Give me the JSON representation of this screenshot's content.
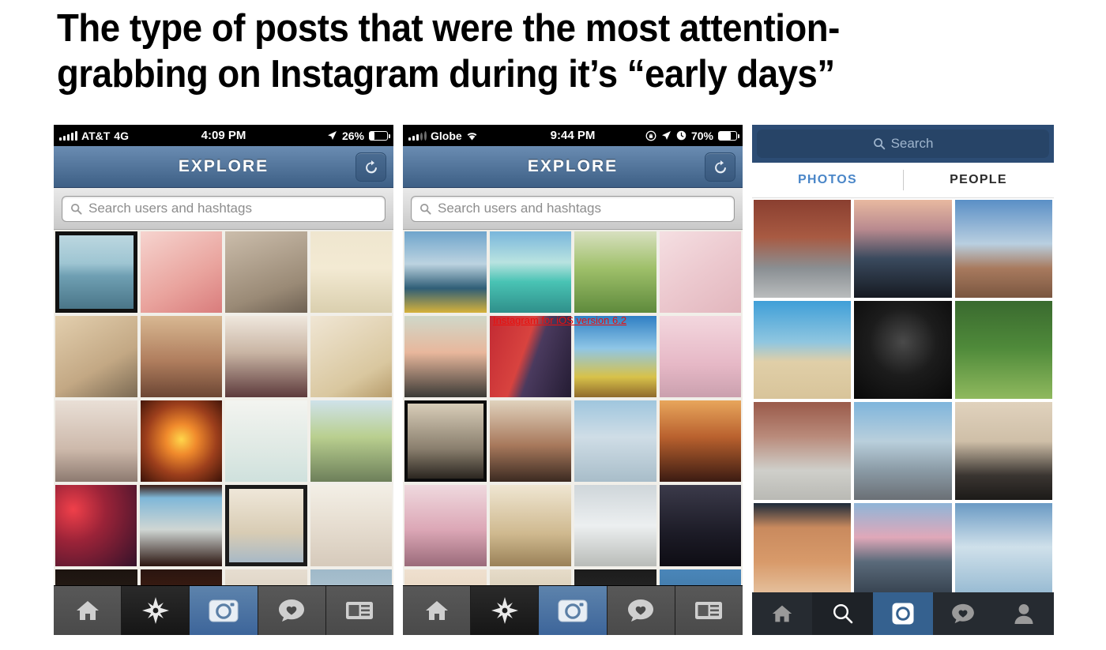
{
  "slide": {
    "title": "The type of posts that were the most attention-grabbing on Instagram during it’s “early days”",
    "background": "#ffffff",
    "annotation": {
      "text": "Instagram for iOS version 6.2",
      "color": "#e8100f"
    }
  },
  "phones": [
    {
      "id": "phone-1",
      "os_style": "ios6",
      "status_bar": {
        "carrier": "AT&T",
        "network": "4G",
        "time": "4:09 PM",
        "battery_percent": "26%",
        "battery_level": 26,
        "icons": [
          "signal-bars-icon",
          "location-arrow-icon",
          "battery-icon"
        ]
      },
      "navbar": {
        "title": "EXPLORE",
        "right_button": "refresh-icon",
        "gradient_top": "#6a8cb2",
        "gradient_bottom": "#3d5f85"
      },
      "search": {
        "placeholder": "Search users and hashtags",
        "icon": "search-icon"
      },
      "grid": {
        "columns": 4,
        "rows": 5,
        "photos": [
          "golden-gate-bridge-bay-view",
          "pink-ladybug-nail-art",
          "jewelry-scattered-on-carpet",
          "cartoon-character-on-tv-screen",
          "pencil-drawing-of-eye-and-nose",
          "sepia-beach-crowd-sunset",
          "girl-peace-sign-striped-shirt",
          "decorated-cupcakes-in-box",
          "girl-in-white-shorts-mirror",
          "orange-sunset-over-ocean",
          "pastel-nail-art-manicure",
          "woman-in-neon-top-by-car",
          "red-light-feet-on-ground",
          "woman-on-pier-city-skyline",
          "ice-cream-dessert-blue-plate",
          "box-of-colorful-macarons",
          "partial-row-bottom"
        ]
      },
      "tabbar": {
        "items": [
          {
            "icon": "home-icon",
            "state": "normal"
          },
          {
            "icon": "explore-star-icon",
            "state": "selected"
          },
          {
            "icon": "camera-icon",
            "state": "highlighted"
          },
          {
            "icon": "heart-bubble-icon",
            "state": "normal"
          },
          {
            "icon": "news-feed-icon",
            "state": "normal"
          }
        ]
      }
    },
    {
      "id": "phone-2",
      "os_style": "ios6",
      "status_bar": {
        "carrier": "Globe",
        "network": "wifi-icon",
        "time": "9:44 PM",
        "battery_percent": "70%",
        "battery_level": 70,
        "icons": [
          "signal-bars-icon",
          "wifi-icon",
          "rotation-lock-icon",
          "location-arrow-icon",
          "alarm-clock-icon",
          "battery-icon"
        ]
      },
      "navbar": {
        "title": "EXPLORE",
        "right_button": "refresh-icon",
        "gradient_top": "#6a8cb2",
        "gradient_bottom": "#3d5f85"
      },
      "search": {
        "placeholder": "Search users and hashtags",
        "icon": "search-icon"
      },
      "grid": {
        "columns": 4,
        "rows": 5,
        "photos": [
          "sailboat-from-yellow-kayak",
          "turquoise-tropical-sea",
          "open-road-through-green-fields",
          "green-pastry-on-checkered-paper",
          "girl-hugging-french-bulldog",
          "bape-ape-head-balloons-display",
          "colorful-harbor-boats-blue-sky",
          "pink-filtered-legs-collage",
          "person-in-black-sitting",
          "pig-and-woman-indoors",
          "mackerel-sky-clouds",
          "orange-sunset-silhouette-tower",
          "three-girls-in-white-outfits",
          "rabbit-in-wicker-basket",
          "white-pomeranian-puppy",
          "selfie-woman-dark-room",
          "partial-row-bottom"
        ]
      },
      "tabbar": {
        "items": [
          {
            "icon": "home-icon",
            "state": "normal"
          },
          {
            "icon": "explore-star-icon",
            "state": "selected"
          },
          {
            "icon": "camera-icon",
            "state": "highlighted"
          },
          {
            "icon": "heart-bubble-icon",
            "state": "normal"
          },
          {
            "icon": "news-feed-icon",
            "state": "normal"
          }
        ]
      }
    },
    {
      "id": "phone-3",
      "os_style": "ios7",
      "search": {
        "placeholder": "Search",
        "icon": "search-icon",
        "bar_color": "#2c4c74",
        "field_color": "#274467"
      },
      "tabs": [
        {
          "label": "PHOTOS",
          "active": true
        },
        {
          "label": "PEOPLE",
          "active": false
        }
      ],
      "active_tab_color": "#4a86c8",
      "grid": {
        "columns": 3,
        "rows": 4,
        "photos": [
          "skateboarder-jumping-city-street",
          "hand-holding-phone-sunset-lake",
          "proposal-on-canyon-cliff",
          "bernese-mountain-dog-on-beach",
          "portrait-woman-dark-background",
          "father-and-child-in-park",
          "two-dogs-on-sidewalk",
          "chicago-cloud-gate-bean",
          "french-bulldog-held-on-beach",
          "feet-on-wooden-floor-with-ropes",
          "person-and-dog-on-dock-at-dusk",
          "aerial-boat-on-blue-water"
        ]
      },
      "tabbar": {
        "items": [
          {
            "icon": "home-icon",
            "state": "normal"
          },
          {
            "icon": "search-icon",
            "state": "selected"
          },
          {
            "icon": "camera-icon",
            "state": "highlighted"
          },
          {
            "icon": "heart-bubble-icon",
            "state": "normal"
          },
          {
            "icon": "person-icon",
            "state": "normal"
          }
        ]
      }
    }
  ]
}
